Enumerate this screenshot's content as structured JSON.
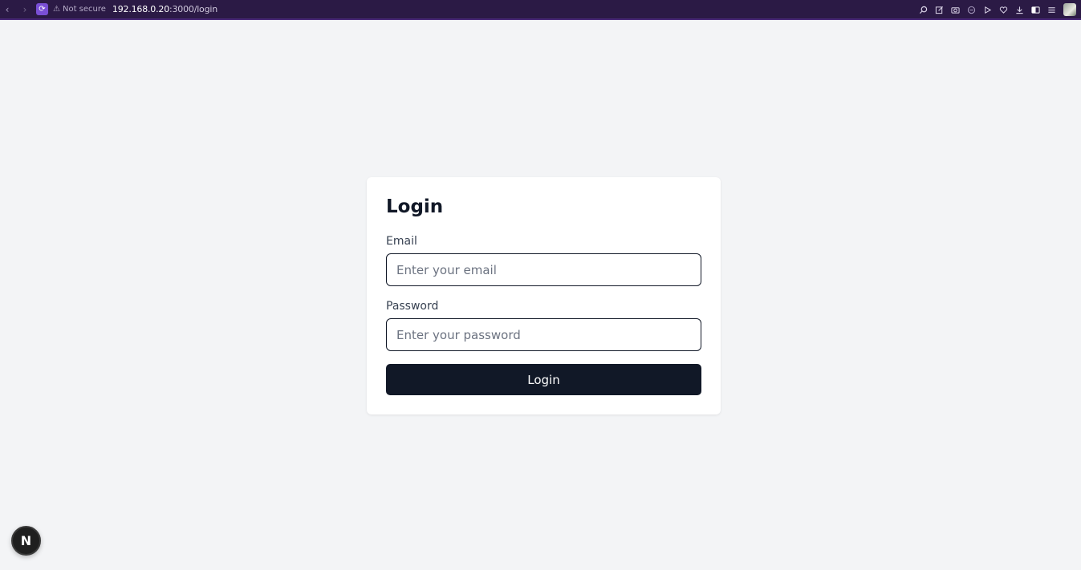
{
  "browser": {
    "back_icon": "‹",
    "forward_icon": "›",
    "reload_icon": "⟳",
    "security_text": "Not secure",
    "url_host": "192.168.0.20",
    "url_path": ":3000/login",
    "toolbar_icons": [
      "zoom-icon",
      "edit-icon",
      "camera-icon",
      "block-icon",
      "play-icon",
      "heart-icon",
      "download-icon",
      "sidebar-icon",
      "menu-icon"
    ]
  },
  "login": {
    "title": "Login",
    "email_label": "Email",
    "email_placeholder": "Enter your email",
    "email_value": "",
    "password_label": "Password",
    "password_placeholder": "Enter your password",
    "password_value": "",
    "submit_label": "Login"
  },
  "badge": {
    "letter": "N"
  },
  "colors": {
    "background": "#f3f4f6",
    "button": "#111827",
    "browser_bar": "#2b1a45",
    "accent": "#7a4fd6"
  }
}
